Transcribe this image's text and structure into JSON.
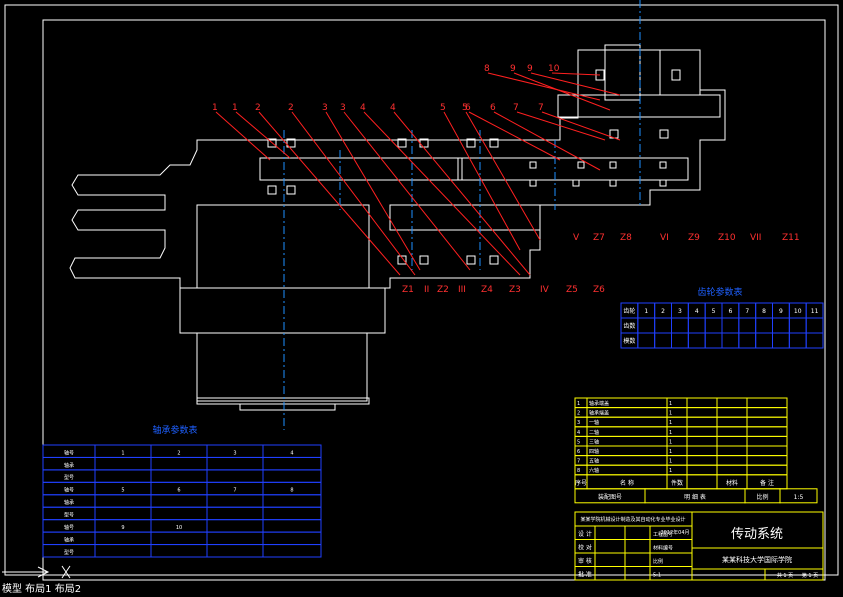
{
  "drawing": {
    "part_labels_top": [
      "1",
      "1",
      "2",
      "2",
      "3",
      "3",
      "4",
      "4",
      "5",
      "5",
      "6",
      "6",
      "7",
      "7",
      "8",
      "9",
      "9",
      "10"
    ],
    "callouts_bottom": [
      "Z1",
      "II",
      "Z2",
      "III",
      "Z4",
      "Z3",
      "IV",
      "Z5",
      "Z6",
      "V",
      "Z7",
      "Z8",
      "VI",
      "Z9",
      "Z10",
      "VII",
      "Z11"
    ]
  },
  "gear_table": {
    "title": "齿轮参数表",
    "rows": [
      [
        "齿轮",
        "1",
        "2",
        "3",
        "4",
        "5",
        "6",
        "7",
        "8",
        "9",
        "10",
        "11"
      ],
      [
        "齿数",
        "",
        "",
        "",
        "",
        "",
        "",
        "",
        "",
        "",
        "",
        ""
      ],
      [
        "模数",
        "",
        "",
        "",
        "",
        "",
        "",
        "",
        "",
        "",
        "",
        ""
      ]
    ]
  },
  "shaft_table": {
    "title": "轴承参数表",
    "header": [
      "轴号",
      "1",
      "2",
      "3",
      "4"
    ],
    "rows": [
      [
        "轴承",
        "",
        "",
        "",
        ""
      ],
      [
        "型号",
        "",
        "",
        "",
        ""
      ],
      [
        "轴号",
        "5",
        "6",
        "7",
        "8"
      ],
      [
        "轴承",
        "",
        "",
        "",
        ""
      ],
      [
        "型号",
        "",
        "",
        "",
        ""
      ],
      [
        "轴号",
        "9",
        "10",
        "",
        ""
      ],
      [
        "轴承",
        "",
        "",
        "",
        ""
      ],
      [
        "型号",
        "",
        "",
        "",
        ""
      ]
    ]
  },
  "parts_list": {
    "rows": [
      [
        "1",
        "轴承端盖",
        "1",
        "",
        ""
      ],
      [
        "2",
        "轴承端盖",
        "1",
        "",
        ""
      ],
      [
        "3",
        "一轴",
        "1",
        "",
        ""
      ],
      [
        "4",
        "二轴",
        "1",
        "",
        ""
      ],
      [
        "5",
        "三轴",
        "1",
        "",
        ""
      ],
      [
        "6",
        "四轴",
        "1",
        "",
        ""
      ],
      [
        "7",
        "五轴",
        "1",
        "",
        ""
      ],
      [
        "8",
        "六轴",
        "1",
        "",
        ""
      ]
    ],
    "header": [
      "序号",
      "名   称",
      "件数",
      "材料",
      "备  注"
    ],
    "detail_row": [
      "装配图号",
      "明    细    表",
      "比例",
      "1:5"
    ]
  },
  "title_block": {
    "school_line": "某某学院机械设计制造及其自动化专业毕业设计",
    "date": "2012年04月",
    "drawing_title": "传动系统",
    "institution": "某某科技大学国际学院",
    "roles": [
      "设 计",
      "校 对",
      "审 核",
      "批 准"
    ],
    "fields": [
      "工程图号",
      "材料编号",
      "比例",
      "5:1"
    ],
    "sheet": "共 1 页",
    "sheet_no": "第 1 页"
  },
  "status": {
    "text": "  模型  布局1  布局2"
  },
  "colors": {
    "background": "#000000",
    "frame": "#ffffff",
    "leader": "#ff0000",
    "centerline": "#1e90ff",
    "table": "#0000ff",
    "parts_table": "#ffff00",
    "table_text": "#ffffff"
  }
}
